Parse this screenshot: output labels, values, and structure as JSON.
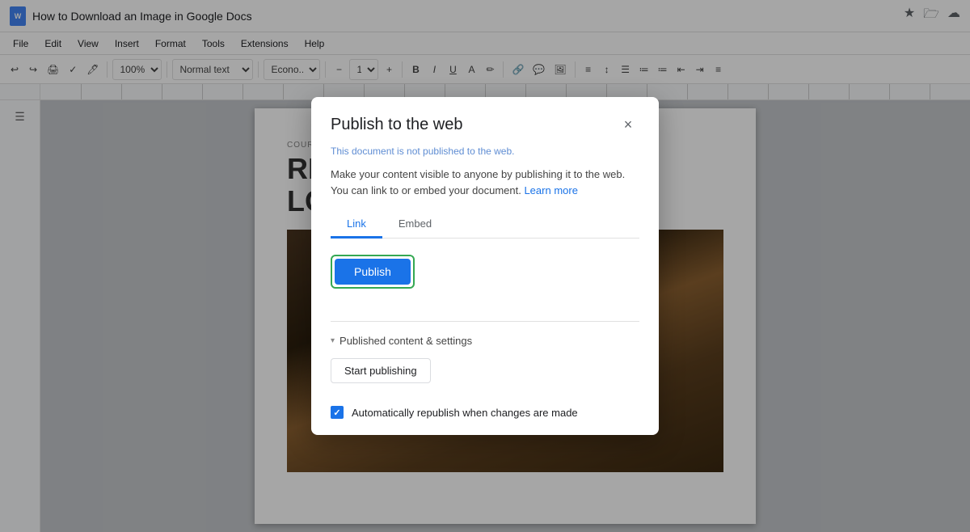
{
  "window": {
    "title": "How to Download an Image in Google Docs",
    "doc_icon_label": "W"
  },
  "menu": {
    "items": [
      "File",
      "Edit",
      "View",
      "Insert",
      "Format",
      "Tools",
      "Extensions",
      "Help"
    ]
  },
  "toolbar": {
    "zoom": "100%",
    "style": "Normal text",
    "font": "Econo..."
  },
  "title_icons": [
    "★",
    "🗁",
    "☁"
  ],
  "document": {
    "course_label": "COURSE NAME",
    "title_line1": "REPOR",
    "title_line2": "LOREM"
  },
  "dialog": {
    "title": "Publish to the web",
    "status": "This document is not published to the web.",
    "description": "Make your content visible to anyone by publishing it to the web. You can link to or embed your document.",
    "learn_more": "Learn more",
    "tabs": [
      "Link",
      "Embed"
    ],
    "active_tab": "Link",
    "publish_button": "Publish",
    "close_button": "×",
    "divider": true,
    "published_section": {
      "label": "Published content & settings",
      "arrow": "▾"
    },
    "start_publishing_button": "Start publishing",
    "auto_republish_label": "Automatically republish when changes are made",
    "checkbox_checked": true
  }
}
